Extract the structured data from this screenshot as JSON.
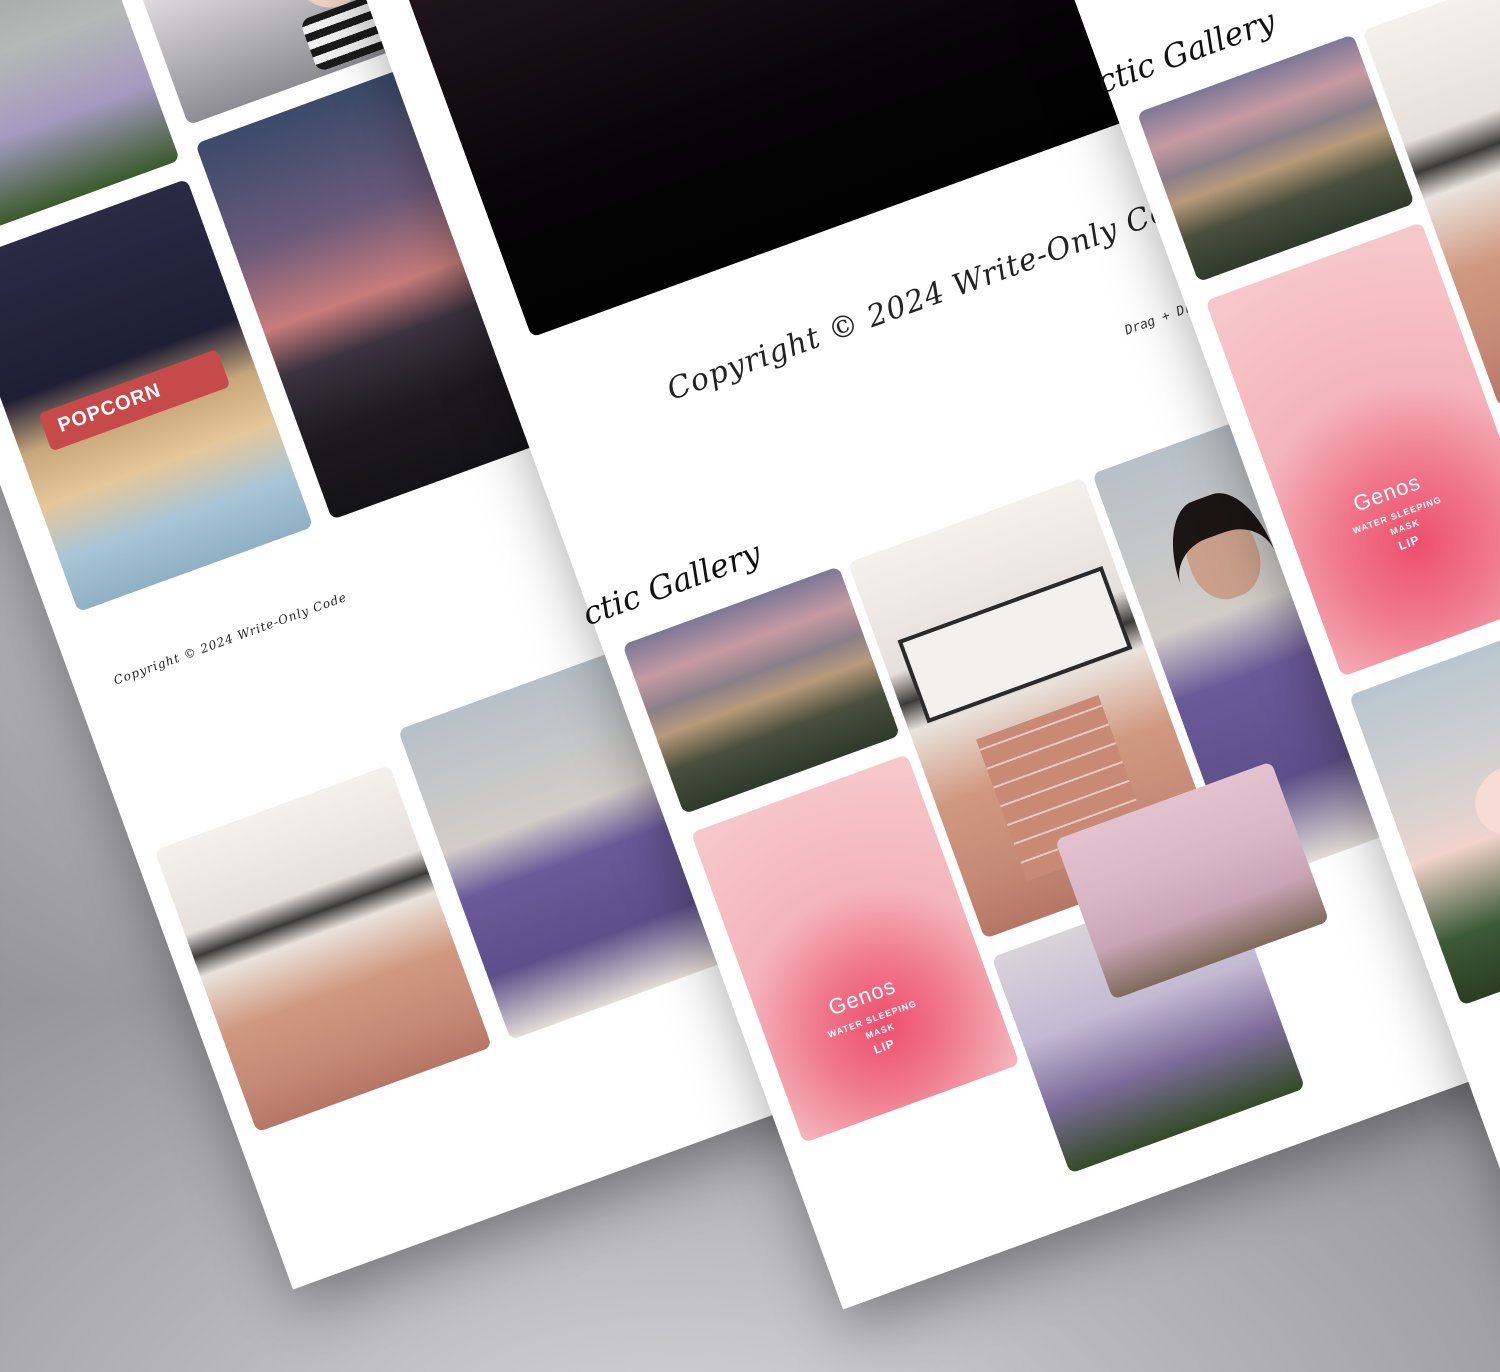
{
  "gallery": {
    "title": "ctic Gallery",
    "copyright": "Copyright © 2024 Write-Only Code",
    "drag_drop": "Drag + Drop an"
  },
  "product_label": {
    "brand": "Genos",
    "line1": "WATER SLEEPING",
    "line2": "MASK",
    "line3": "LIP"
  },
  "popcorn_sign": "POPCORN",
  "colors": {
    "background": "#a7a7ab",
    "sheet": "#ffffff",
    "text": "#222222"
  }
}
